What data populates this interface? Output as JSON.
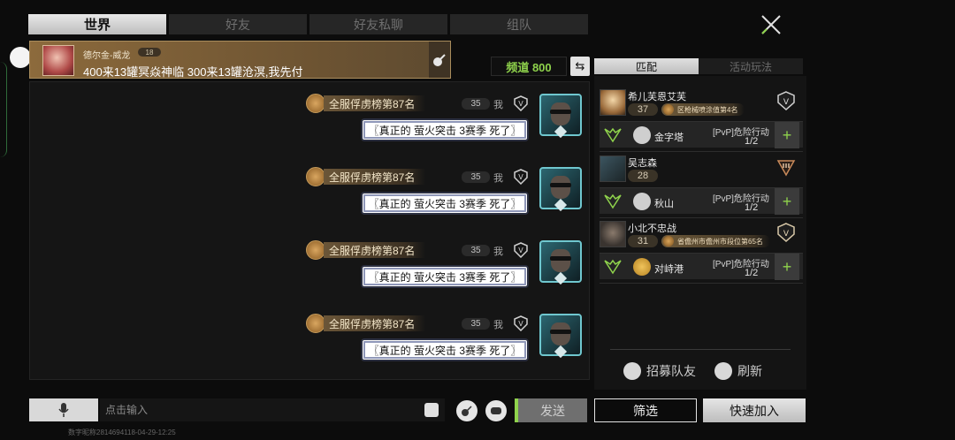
{
  "tabs": [
    {
      "label": "世界",
      "active": true
    },
    {
      "label": "好友",
      "active": false
    },
    {
      "label": "好友私聊",
      "active": false
    },
    {
      "label": "组队",
      "active": false
    }
  ],
  "banner": {
    "name": "德尔金-威龙",
    "level": "18",
    "text": "400来13罐冥焱神临 300来13罐沧溟,我先付"
  },
  "channel": {
    "label": "频道 800"
  },
  "messages": [
    {
      "rank_title": "全服俘虏榜第87名",
      "level": "35",
      "me_label": "我",
      "text": "〖真正的 萤火突击 3赛季 死了〗"
    },
    {
      "rank_title": "全服俘虏榜第87名",
      "level": "35",
      "me_label": "我",
      "text": "〖真正的 萤火突击 3赛季 死了〗"
    },
    {
      "rank_title": "全服俘虏榜第87名",
      "level": "35",
      "me_label": "我",
      "text": "〖真正的 萤火突击 3赛季 死了〗"
    },
    {
      "rank_title": "全服俘虏榜第87名",
      "level": "35",
      "me_label": "我",
      "text": "〖真正的 萤火突击 3赛季 死了〗"
    }
  ],
  "right_tabs": [
    {
      "label": "匹配",
      "active": true
    },
    {
      "label": "活动玩法",
      "active": false
    }
  ],
  "teams": [
    {
      "name": "希儿芙恩艾芙",
      "level": "37",
      "title": "区枪械喷涂值第4名",
      "map": "金字塔",
      "mode": "[PvP]危险行动",
      "count": "1/2"
    },
    {
      "name": "吴志森",
      "level": "28",
      "title": "",
      "map": "秋山",
      "mode": "[PvP]危险行动",
      "count": "1/2"
    },
    {
      "name": "小北不忠战",
      "level": "31",
      "title": "省儋州市儋州市段位第65名",
      "map": "对峙港",
      "mode": "[PvP]危险行动",
      "count": "1/2"
    }
  ],
  "join_symbol": "+",
  "actions": {
    "recruit": "招募队友",
    "refresh": "刷新"
  },
  "input": {
    "placeholder": "点击输入"
  },
  "buttons": {
    "send": "发送",
    "filter": "筛选",
    "quick_join": "快速加入"
  },
  "watermark": "数字昵称2814694118-04-29-12:25",
  "colors": {
    "accent_green": "#8fd34c",
    "gold": "#8c6a3c"
  }
}
